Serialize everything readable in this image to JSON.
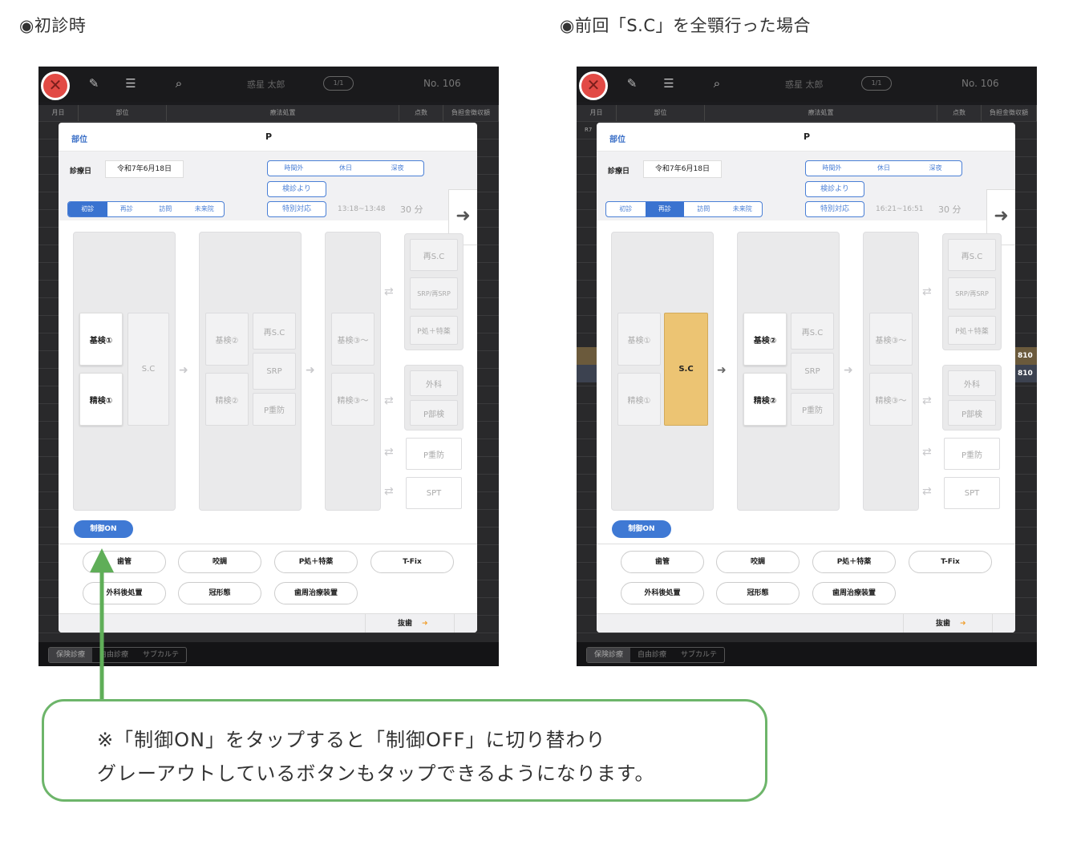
{
  "headings": {
    "left": "◉初診時",
    "right": "◉前回「S.C」を全顎行った場合"
  },
  "topbar": {
    "patient_name": "惑星 太郎",
    "page": "1/1",
    "record_no": "No. 106"
  },
  "columns": [
    "月日",
    "部位",
    "療法処置",
    "点数",
    "負担金徴収額"
  ],
  "modal": {
    "site_label": "部位",
    "site_value": "P",
    "date_label": "診療日",
    "date_value": "令和7年6月18日",
    "time_tabs": [
      "時間外",
      "休日",
      "深夜"
    ],
    "kenshin_label": "検診より",
    "tokubetsu_label": "特別対応",
    "visit_tabs": [
      "初診",
      "再診",
      "訪問",
      "未来院"
    ],
    "minutes": "30 分",
    "flow": {
      "kiken1": "基検①",
      "seiken1": "精検①",
      "sc": "S.C",
      "kiken2": "基検②",
      "seiken2": "精検②",
      "re_sc": "再S.C",
      "srp": "SRP",
      "p_juubou": "P重防",
      "kiken3": "基検③〜",
      "seiken3": "精検③〜",
      "side_re_sc": "再S.C",
      "side_srp": "SRP/再SRP",
      "side_p_toku": "P処＋特薬",
      "side_geka": "外科",
      "side_p_bu": "P部検",
      "side_p_juubou": "P重防",
      "side_spt": "SPT"
    },
    "control_on": "制御ON",
    "options": [
      "歯管",
      "咬調",
      "P処＋特薬",
      "T-Fix",
      "外科後処置",
      "冠形態",
      "歯周治療装置"
    ],
    "extract": "抜歯"
  },
  "screen_left": {
    "selected_visit": "初診",
    "time_range": "13:18~13:48"
  },
  "screen_right": {
    "selected_visit": "再診",
    "time_range": "16:21~16:51"
  },
  "bottom_tabs": [
    "保険診療",
    "自由診療",
    "サブカルテ"
  ],
  "right_row_values": [
    "810",
    "810"
  ],
  "right_row_prefix": "R7",
  "callout": {
    "line1": "※「制御ON」をタップすると「制御OFF」に切り替わり",
    "line2": "グレーアウトしているボタンもタップできるようになります。"
  },
  "colors": {
    "accent": "#3a73d0",
    "selected": "#ecc473",
    "close": "#e24a45",
    "callout_border": "#6db56a"
  }
}
